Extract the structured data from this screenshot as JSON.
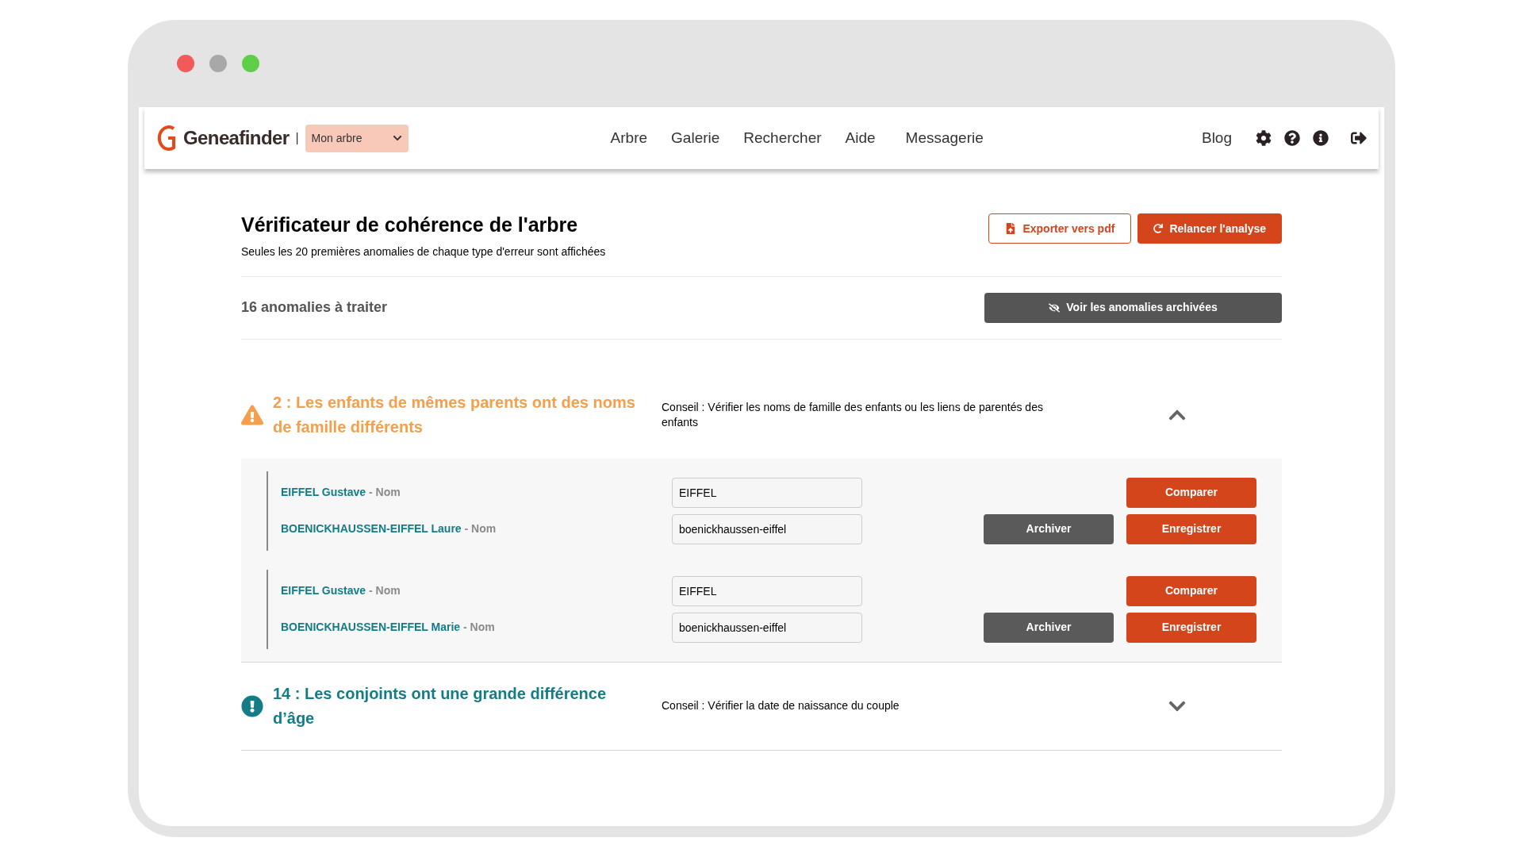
{
  "header": {
    "brand": "Geneafinder",
    "separator": "|",
    "tree_select": "Mon arbre",
    "nav": [
      "Arbre",
      "Galerie",
      "Rechercher",
      "Aide",
      "Messagerie"
    ],
    "blog": "Blog"
  },
  "page": {
    "title": "Vérificateur de cohérence de l'arbre",
    "subtitle": "Seules les 20 premières anomalies de chaque type d'erreur sont affichées",
    "export_button": "Exporter vers pdf",
    "rerun_button": "Relancer l'analyse",
    "count": "16 anomalies à traiter",
    "archived_button": "Voir les anomalies archivées"
  },
  "issues": [
    {
      "kind": "warning",
      "title": "2 : Les enfants de mêmes parents ont des noms de famille différents",
      "advice": "Conseil : Vérifier les noms de famille des enfants ou les liens de parentés des enfants",
      "expanded": true,
      "groups": [
        {
          "rows": [
            {
              "person": "EIFFEL Gustave",
              "field": "- Nom",
              "value": "EIFFEL",
              "buttons": [
                {
                  "kind": "primary",
                  "label": "Comparer"
                }
              ]
            },
            {
              "person": "BOENICKHAUSSEN-EIFFEL Laure",
              "field": "- Nom",
              "value": "boenickhaussen-eiffel",
              "buttons": [
                {
                  "kind": "secondary",
                  "label": "Archiver"
                },
                {
                  "kind": "primary",
                  "label": "Enregistrer"
                }
              ]
            }
          ]
        },
        {
          "rows": [
            {
              "person": "EIFFEL Gustave",
              "field": "- Nom",
              "value": "EIFFEL",
              "buttons": [
                {
                  "kind": "primary",
                  "label": "Comparer"
                }
              ]
            },
            {
              "person": "BOENICKHAUSSEN-EIFFEL Marie",
              "field": "- Nom",
              "value": "boenickhaussen-eiffel",
              "buttons": [
                {
                  "kind": "secondary",
                  "label": "Archiver"
                },
                {
                  "kind": "primary",
                  "label": "Enregistrer"
                }
              ]
            }
          ]
        }
      ]
    },
    {
      "kind": "info",
      "title": "14 : Les conjoints ont une grande différence d’âge",
      "advice": "Conseil : Vérifier la date de naissance du couple",
      "expanded": false
    }
  ]
}
